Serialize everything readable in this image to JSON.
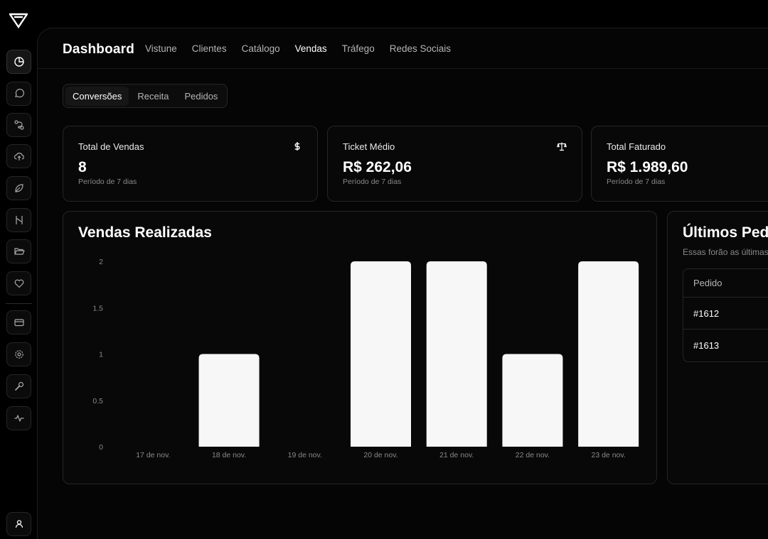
{
  "sidebar": {
    "logo": "brand-logo",
    "icons": [
      "pie-chart-icon",
      "chat-icon",
      "route-icon",
      "cloud-upload-icon",
      "leaf-icon",
      "paths-icon",
      "folder-open-icon",
      "heart-icon",
      "credit-card-icon",
      "settings-icon",
      "wrench-icon",
      "activity-icon"
    ],
    "profile": "user-icon"
  },
  "header": {
    "title": "Dashboard",
    "nav": [
      "Vistune",
      "Clientes",
      "Catálogo",
      "Vendas",
      "Tráfego",
      "Redes Sociais"
    ],
    "active_nav": "Vendas"
  },
  "subtabs": {
    "items": [
      "Conversões",
      "Receita",
      "Pedidos"
    ],
    "active": "Conversões"
  },
  "stats": [
    {
      "title": "Total de Vendas",
      "value": "8",
      "sub": "Período de 7 dias",
      "icon": "dollar-icon"
    },
    {
      "title": "Ticket Médio",
      "value": "R$ 262,06",
      "sub": "Período de 7 dias",
      "icon": "scale-icon"
    },
    {
      "title": "Total Faturado",
      "value": "R$ 1.989,60",
      "sub": "Período de 7 dias",
      "icon": ""
    }
  ],
  "chart_data": {
    "type": "bar",
    "title": "Vendas Realizadas",
    "categories": [
      "17 de nov.",
      "18 de nov.",
      "19 de nov.",
      "20 de nov.",
      "21 de nov.",
      "22 de nov.",
      "23 de nov."
    ],
    "values": [
      0,
      1,
      0,
      2,
      2,
      1,
      2
    ],
    "ylim": [
      0,
      2
    ],
    "yticks": [
      "2",
      "1.5",
      "1",
      "0.5",
      "0"
    ],
    "xlabel": "",
    "ylabel": "",
    "grid": false,
    "bar_color": "#f7f7f7"
  },
  "orders": {
    "title": "Últimos Pedidos",
    "subtitle": "Essas forão as últimas",
    "column": "Pedido",
    "rows": [
      "#1612",
      "#1613"
    ]
  },
  "colors": {
    "background": "#000000",
    "panel": "#050505",
    "border": "#252525",
    "accent": "#ffffff"
  }
}
